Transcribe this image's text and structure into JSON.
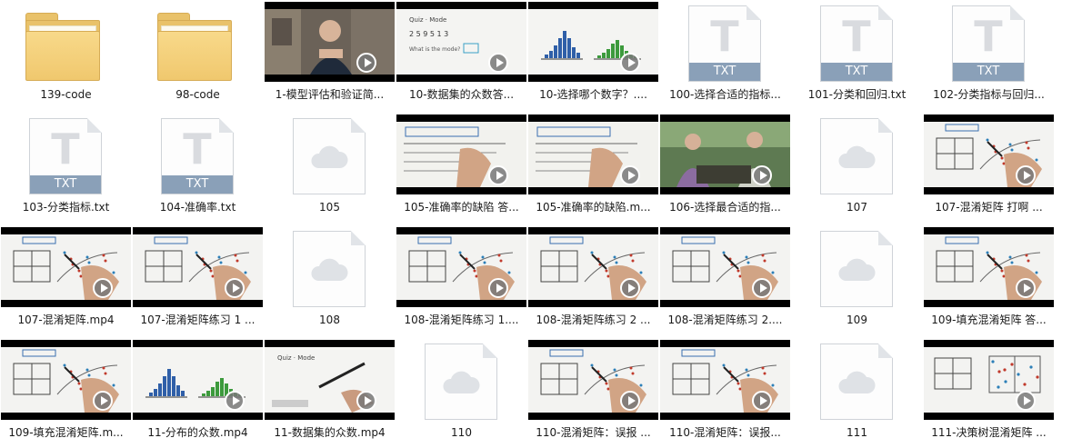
{
  "items": [
    {
      "type": "folder",
      "label": "139-code"
    },
    {
      "type": "folder",
      "label": "98-code"
    },
    {
      "type": "video",
      "label": "1-模型评估和验证简...",
      "scene": "person"
    },
    {
      "type": "video",
      "label": "10-数据集的众数答...",
      "scene": "quiz"
    },
    {
      "type": "video",
      "label": "10-选择哪个数字？....",
      "scene": "hist"
    },
    {
      "type": "txt",
      "label": "100-选择合适的指标...",
      "ext": "TXT"
    },
    {
      "type": "txt",
      "label": "101-分类和回归.txt",
      "ext": "TXT"
    },
    {
      "type": "txt",
      "label": "102-分类指标与回归...",
      "ext": "TXT"
    },
    {
      "type": "txt",
      "label": "103-分类指标.txt",
      "ext": "TXT"
    },
    {
      "type": "txt",
      "label": "104-准确率.txt",
      "ext": "TXT"
    },
    {
      "type": "file",
      "label": "105"
    },
    {
      "type": "video",
      "label": "105-准确率的缺陷 答...",
      "scene": "notes"
    },
    {
      "type": "video",
      "label": "105-准确率的缺陷.m...",
      "scene": "notes"
    },
    {
      "type": "video",
      "label": "106-选择最合适的指...",
      "scene": "people"
    },
    {
      "type": "file",
      "label": "107"
    },
    {
      "type": "video",
      "label": "107-混淆矩阵 打啊 ...",
      "scene": "matrix"
    },
    {
      "type": "video",
      "label": "107-混淆矩阵.mp4",
      "scene": "matrix"
    },
    {
      "type": "video",
      "label": "107-混淆矩阵练习 1 ...",
      "scene": "matrix"
    },
    {
      "type": "file",
      "label": "108"
    },
    {
      "type": "video",
      "label": "108-混淆矩阵练习 1....",
      "scene": "matrix"
    },
    {
      "type": "video",
      "label": "108-混淆矩阵练习 2 ...",
      "scene": "matrix"
    },
    {
      "type": "video",
      "label": "108-混淆矩阵练习 2....",
      "scene": "matrix"
    },
    {
      "type": "file",
      "label": "109"
    },
    {
      "type": "video",
      "label": "109-填充混淆矩阵 答...",
      "scene": "matrix"
    },
    {
      "type": "video",
      "label": "109-填充混淆矩阵.m...",
      "scene": "matrix"
    },
    {
      "type": "video",
      "label": "11-分布的众数.mp4",
      "scene": "hist"
    },
    {
      "type": "video",
      "label": "11-数据集的众数.mp4",
      "scene": "quiz2"
    },
    {
      "type": "file",
      "label": "110"
    },
    {
      "type": "video",
      "label": "110-混淆矩阵：误报 ...",
      "scene": "matrix"
    },
    {
      "type": "video",
      "label": "110-混淆矩阵：误报...",
      "scene": "matrix"
    },
    {
      "type": "file",
      "label": "111"
    },
    {
      "type": "video",
      "label": "111-决策树混淆矩阵 ...",
      "scene": "tree"
    }
  ],
  "colors": {
    "folder": "#f0c86e",
    "txt_band": "#8aa0b8",
    "cloud": "#dfe2e6"
  }
}
